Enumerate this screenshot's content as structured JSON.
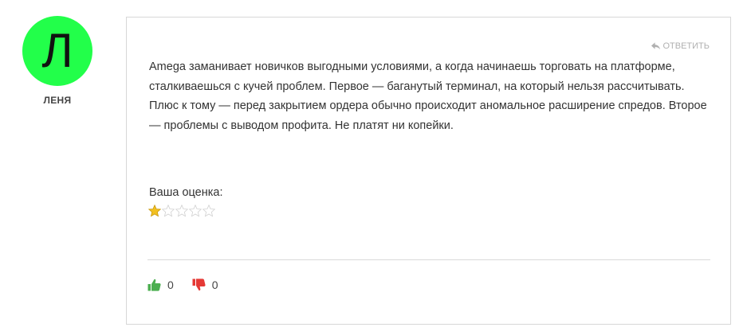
{
  "author": {
    "initial": "Л",
    "name": "ЛЕНЯ",
    "avatar_color": "#22ff4a"
  },
  "comment": {
    "reply_label": "ОТВЕТИТЬ",
    "text": "Amega заманивает новичков выгодными условиями, а когда начинаешь торговать на платформе, сталкиваешься с кучей проблем. Первое — баганутый терминал, на который нельзя рассчитывать. Плюс к тому — перед закрытием ордера обычно происходит аномальное расширение спредов. Второе — проблемы с выводом профита. Не платят ни копейки.",
    "rating_label": "Ваша оценка:",
    "rating": 1,
    "rating_max": 5
  },
  "votes": {
    "likes": "0",
    "dislikes": "0",
    "like_color": "#4caf50",
    "dislike_color": "#e53935"
  },
  "icons": {
    "reply": "reply-arrow-icon",
    "like": "thumbs-up-icon",
    "dislike": "thumbs-down-icon",
    "star": "star-icon"
  }
}
